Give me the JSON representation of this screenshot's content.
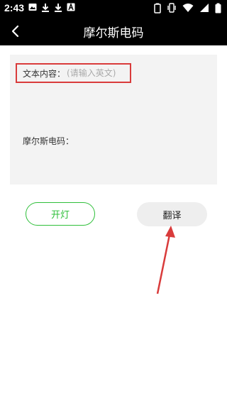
{
  "status_bar": {
    "time": "2:43",
    "left_icons": [
      "image-icon",
      "download-icon",
      "download-icon",
      "text-icon"
    ],
    "right_icons": [
      "battery-icon",
      "vibrate-icon",
      "wifi-icon",
      "signal-icon",
      "battery-full-icon"
    ]
  },
  "appbar": {
    "back_icon": "chevron-left-icon",
    "title": "摩尔斯电码"
  },
  "form": {
    "text_label": "文本内容：",
    "text_placeholder": "(请输入英文)",
    "text_value": "",
    "morse_label": "摩尔斯电码："
  },
  "buttons": {
    "light": "开灯",
    "translate": "翻译"
  },
  "colors": {
    "bar_bg": "#000000",
    "panel_bg": "#f3f3f3",
    "highlight_red": "#d93b3b",
    "green": "#2fbf3a",
    "translate_bg": "#eeeeee"
  }
}
